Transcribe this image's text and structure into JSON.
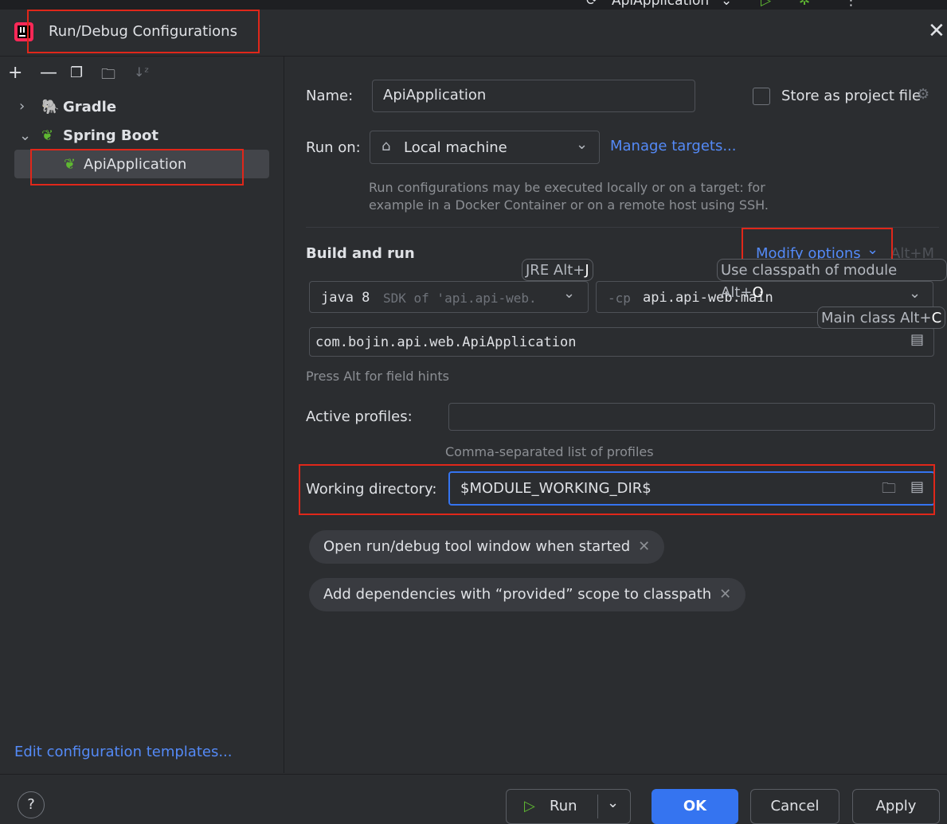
{
  "top": {
    "config_name": "ApiApplication"
  },
  "dialog": {
    "title": "Run/Debug Configurations"
  },
  "tree": {
    "groups": [
      {
        "label": "Gradle"
      },
      {
        "label": "Spring Boot",
        "children": [
          {
            "label": "ApiApplication",
            "selected": true
          }
        ]
      }
    ],
    "edit_templates": "Edit configuration templates..."
  },
  "form": {
    "name_label": "Name:",
    "name_value": "ApiApplication",
    "store_label": "Store as project file",
    "runon_label": "Run on:",
    "runon_value": "Local machine",
    "manage_targets": "Manage targets...",
    "runon_help_1": "Run configurations may be executed locally or on a target: for",
    "runon_help_2": "example in a Docker Container or on a remote host using SSH.",
    "build_run_label": "Build and run",
    "modify_options": "Modify options",
    "modify_shortcut": "Alt+M",
    "jre_hint_text": "JRE Alt+",
    "jre_hint_key": "J",
    "classpath_hint_text": "Use classpath of module Alt+",
    "classpath_hint_key": "O",
    "mainclass_hint_text": "Main class Alt+",
    "mainclass_hint_key": "C",
    "jdk_main": "java 8",
    "jdk_sub": "SDK of 'api.api-web.",
    "cp_prefix": "-cp",
    "cp_value": "api.api-web.main",
    "main_class": "com.bojin.api.web.ApiApplication",
    "press_alt": "Press Alt for field hints",
    "profiles_label": "Active profiles:",
    "profiles_value": "",
    "profiles_help": "Comma-separated list of profiles",
    "workdir_label": "Working directory:",
    "workdir_value": "$MODULE_WORKING_DIR$",
    "chips": [
      "Open run/debug tool window when started",
      "Add dependencies with “provided” scope to classpath"
    ]
  },
  "footer": {
    "help": "?",
    "run": "Run",
    "ok": "OK",
    "cancel": "Cancel",
    "apply": "Apply"
  },
  "colors": {
    "accent": "#3574f0",
    "link": "#548af7",
    "highlight": "#e0271a",
    "spring": "#5fb832"
  }
}
